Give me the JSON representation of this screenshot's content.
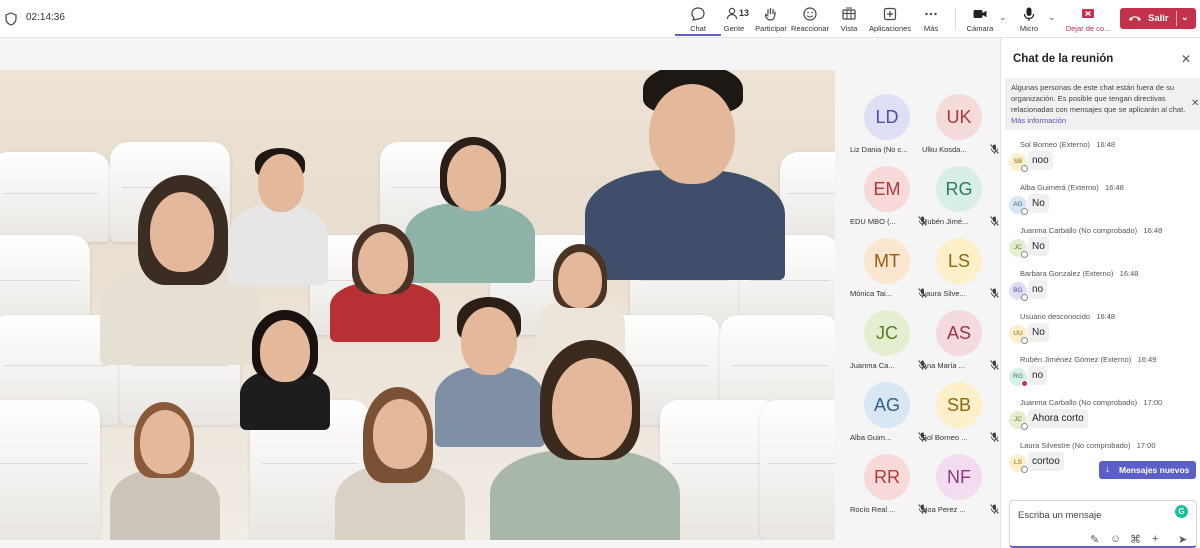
{
  "header": {
    "timer": "02:14:36",
    "people_count": "13",
    "toolbar": [
      {
        "id": "chat",
        "label": "Chat",
        "icon": "chat-icon"
      },
      {
        "id": "people",
        "label": "Gente",
        "icon": "people-icon"
      },
      {
        "id": "raise",
        "label": "Participar",
        "icon": "raise-hand-icon"
      },
      {
        "id": "react",
        "label": "Reaccionar",
        "icon": "smiley-icon"
      },
      {
        "id": "view",
        "label": "Vista",
        "icon": "view-icon"
      },
      {
        "id": "apps",
        "label": "Aplicaciones",
        "icon": "plus-square-icon"
      },
      {
        "id": "more",
        "label": "Más",
        "icon": "ellipsis-icon"
      },
      {
        "id": "camera",
        "label": "Cámara",
        "icon": "camera-icon"
      },
      {
        "id": "mic",
        "label": "Micro",
        "icon": "mic-icon"
      },
      {
        "id": "share",
        "label": "Dejar de co...",
        "icon": "stop-share-icon"
      }
    ],
    "leave_label": "Salir",
    "colors": {
      "accent": "#5b5fc7",
      "leave": "#c4314b",
      "stop_share": "#c4314b"
    }
  },
  "participants": [
    {
      "initials": "LD",
      "name": "Liz Dania (No c...",
      "bg": "#dedff4",
      "fg": "#4b4fa6"
    },
    {
      "initials": "UK",
      "name": "Ulku Kosda...",
      "bg": "#f5dada",
      "fg": "#a53a3a"
    },
    {
      "initials": "EM",
      "name": "EDU MBO (...",
      "bg": "#f7d9d9",
      "fg": "#b13b3b"
    },
    {
      "initials": "RG",
      "name": "Rubén Jimé...",
      "bg": "#d7efe6",
      "fg": "#2e7d5f"
    },
    {
      "initials": "MT",
      "name": "Mónica Tai...",
      "bg": "#fbe6cf",
      "fg": "#9a5a12"
    },
    {
      "initials": "LS",
      "name": "Laura Silve...",
      "bg": "#fcefc9",
      "fg": "#8a6a0b"
    },
    {
      "initials": "JC",
      "name": "Juanma Ca...",
      "bg": "#e4efd2",
      "fg": "#5d7a25"
    },
    {
      "initials": "AS",
      "name": "Ana María ...",
      "bg": "#f4d9de",
      "fg": "#9e3346"
    },
    {
      "initials": "AG",
      "name": "Alba Guim...",
      "bg": "#d9e6f3",
      "fg": "#305f8e"
    },
    {
      "initials": "SB",
      "name": "Sol Borneo ...",
      "bg": "#fcefc9",
      "fg": "#8a6a0b"
    },
    {
      "initials": "RR",
      "name": "Rocío Real ...",
      "bg": "#f7d9d9",
      "fg": "#b13b3b"
    },
    {
      "initials": "NF",
      "name": "Noa Perez ...",
      "bg": "#f3dcef",
      "fg": "#8e3a82"
    }
  ],
  "chat": {
    "title": "Chat de la reunión",
    "notice": "Algunas personas de este chat están fuera de su organización. Es posible que tengan directivas relacionadas con mensajes que se aplicarán al chat.",
    "notice_link": "Más información",
    "messages": [
      {
        "author": "Sol Borneo (Externo)",
        "time": "16:48",
        "initials": "SB",
        "text": "noo",
        "bg": "#fcefc9",
        "fg": "#8a6a0b",
        "status": "away"
      },
      {
        "author": "Alba Guimerá (Externo)",
        "time": "16:48",
        "initials": "AG",
        "text": "No",
        "bg": "#d9e6f3",
        "fg": "#305f8e",
        "status": "away"
      },
      {
        "author": "Juanma Carballo (No comprobado)",
        "time": "16:48",
        "initials": "JC",
        "text": "No",
        "bg": "#e4efd2",
        "fg": "#5d7a25",
        "status": "away"
      },
      {
        "author": "Barbara Gonzalez (Externo)",
        "time": "16:48",
        "initials": "BG",
        "text": "no",
        "bg": "#dedff4",
        "fg": "#4b4fa6",
        "status": "away"
      },
      {
        "author": "Usuario desconocido",
        "time": "16:48",
        "initials": "UU",
        "text": "No",
        "bg": "#fcefc9",
        "fg": "#8a6a0b",
        "status": "away"
      },
      {
        "author": "Rubén Jiménez Gómez (Externo)",
        "time": "16:49",
        "initials": "RG",
        "text": "no",
        "bg": "#d7efe6",
        "fg": "#2e7d5f",
        "status": "busy"
      },
      {
        "author": "Juanma Carballo (No comprobado)",
        "time": "17:00",
        "initials": "JC",
        "text": "Ahora corto",
        "bg": "#e4efd2",
        "fg": "#5d7a25",
        "status": "away"
      },
      {
        "author": "Laura Silvestre (No comprobado)",
        "time": "17:00",
        "initials": "LS",
        "text": "cortoo",
        "bg": "#fcefc9",
        "fg": "#8a6a0b",
        "status": "away"
      }
    ],
    "new_messages_label": "Mensajes nuevos",
    "compose_placeholder": "Escriba un mensaje"
  }
}
